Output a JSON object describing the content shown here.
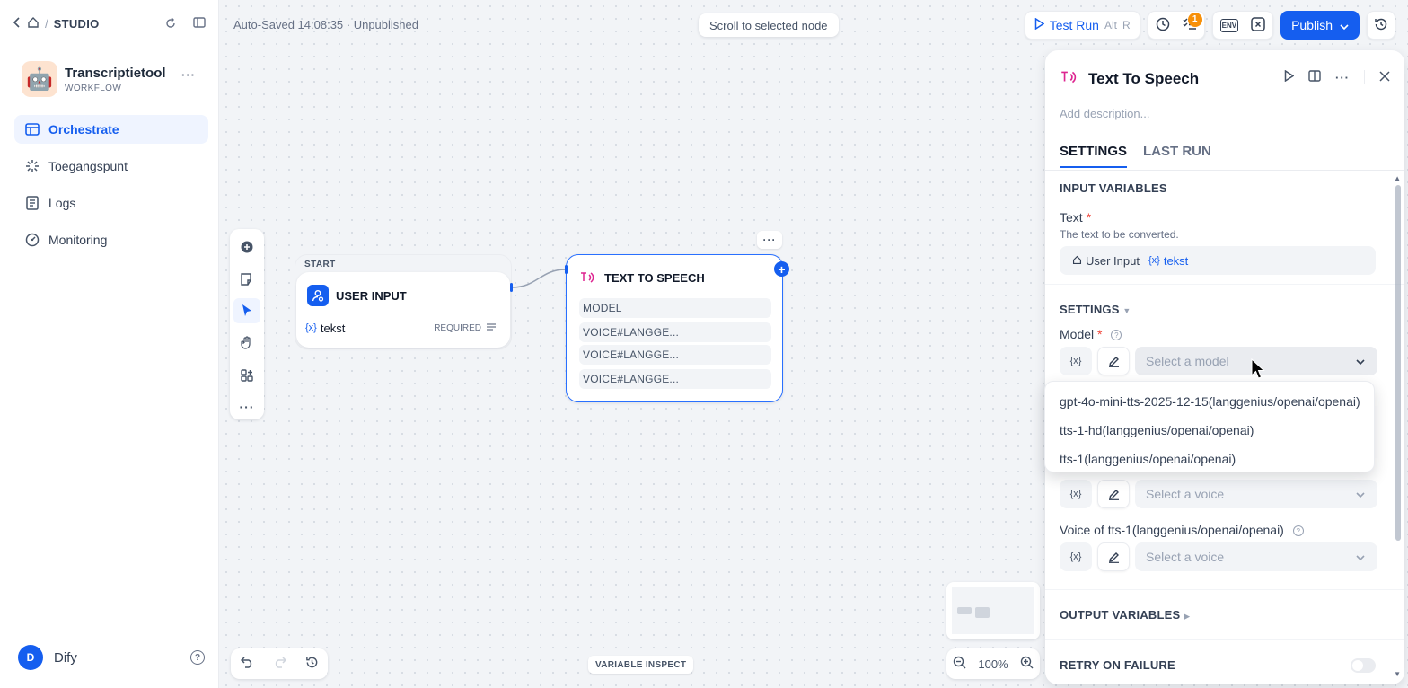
{
  "sidebar": {
    "breadcrumb": {
      "home_sep": "/",
      "studio": "STUDIO"
    },
    "app": {
      "name": "Transcriptietool",
      "kind": "WORKFLOW",
      "icon": "🤖"
    },
    "nav": [
      {
        "label": "Orchestrate",
        "icon": "orchestrate-icon",
        "active": true
      },
      {
        "label": "Toegangspunt",
        "icon": "access-point-icon",
        "active": false
      },
      {
        "label": "Logs",
        "icon": "logs-icon",
        "active": false
      },
      {
        "label": "Monitoring",
        "icon": "monitoring-icon",
        "active": false
      }
    ],
    "user": {
      "initial": "D",
      "name": "Dify"
    }
  },
  "header": {
    "autosave": "Auto-Saved 14:08:35 · Unpublished",
    "scroll_to_selected": "Scroll to selected node",
    "test_run": "Test Run",
    "test_run_kbd1": "Alt",
    "test_run_kbd2": "R",
    "checklist_badge": "1",
    "env_label": "ENV",
    "publish": "Publish"
  },
  "canvas": {
    "start_group_label": "START",
    "start_node": {
      "title": "USER INPUT",
      "var_prefix": "{x}",
      "var_name": "tekst",
      "required": "REQUIRED"
    },
    "tts_node": {
      "title": "TEXT TO SPEECH",
      "fields": [
        "MODEL",
        "VOICE#LANGGE...",
        "VOICE#LANGGE...",
        "VOICE#LANGGE..."
      ]
    },
    "variable_inspect": "VARIABLE INSPECT",
    "zoom": "100%"
  },
  "panel": {
    "title": "Text To Speech",
    "description_placeholder": "Add description...",
    "tabs": [
      "SETTINGS",
      "LAST RUN"
    ],
    "input_variables_title": "INPUT VARIABLES",
    "text_label": "Text",
    "required_mark": "*",
    "text_hint": "The text to be converted.",
    "text_var_source": "User Input",
    "text_var_prefix": "{x}",
    "text_var_name": "tekst",
    "settings_title": "SETTINGS",
    "model_label": "Model",
    "var_btn": "{x}",
    "model_placeholder": "Select a model",
    "voice_placeholder": "Select a voice",
    "voice_label_3": "Voice of tts-1(langgenius/openai/openai)",
    "output_variables_title": "OUTPUT VARIABLES",
    "retry_title": "RETRY ON FAILURE",
    "dropdown_options": [
      "gpt-4o-mini-tts-2025-12-15(langgenius/openai/openai)",
      "tts-1-hd(langgenius/openai/openai)",
      "tts-1(langgenius/openai/openai)"
    ]
  },
  "colors": {
    "accent": "#155eef",
    "tts_pink": "#dd2590",
    "required_red": "#f04438",
    "badge_orange": "#f79009"
  }
}
